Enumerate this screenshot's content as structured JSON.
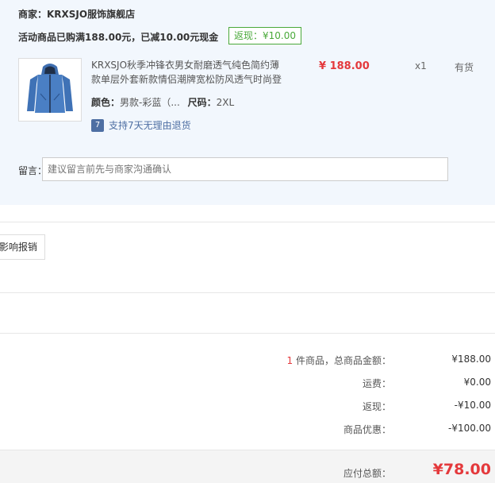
{
  "shop": {
    "merchant_label": "商家：KRXSJO服饰旗舰店",
    "promo_text": "活动商品已购满188.00元，已减10.00元现金",
    "rebate_badge": "返现：¥10.00"
  },
  "product": {
    "title_line1": "KRXSJO秋季冲锋衣男女耐磨透气纯色简约薄",
    "title_line2": "款单层外套新款情侣潮牌宽松防风透气时尚登",
    "price": "¥ 188.00",
    "quantity": "x1",
    "stock_status": "有货",
    "color_label": "颜色：",
    "color_value": "男款-彩蓝（...",
    "size_label": "尺码：",
    "size_value": "2XL",
    "return_icon_text": "7",
    "return_policy": "支持7天无理由退货",
    "image_icon": "jacket-icon"
  },
  "message": {
    "label": "留言：",
    "placeholder": "建议留言前先与商家沟通确认"
  },
  "invoice": {
    "button_partial": "影响报销"
  },
  "summary": {
    "count": "1",
    "count_suffix": " 件商品，总商品金额：",
    "goods_total": "¥188.00",
    "shipping_label": "运费：",
    "shipping_value": "¥0.00",
    "rebate_label": "返现：",
    "rebate_value": "-¥10.00",
    "discount_label": "商品优惠：",
    "discount_value": "-¥100.00",
    "payable_label": "应付总额：",
    "payable_value": "¥78.00"
  },
  "colors": {
    "price_red": "#e4393c",
    "rebate_green": "#4aa93a",
    "panel_bg": "#f2f7fd",
    "link_blue": "#4e6fa3"
  }
}
